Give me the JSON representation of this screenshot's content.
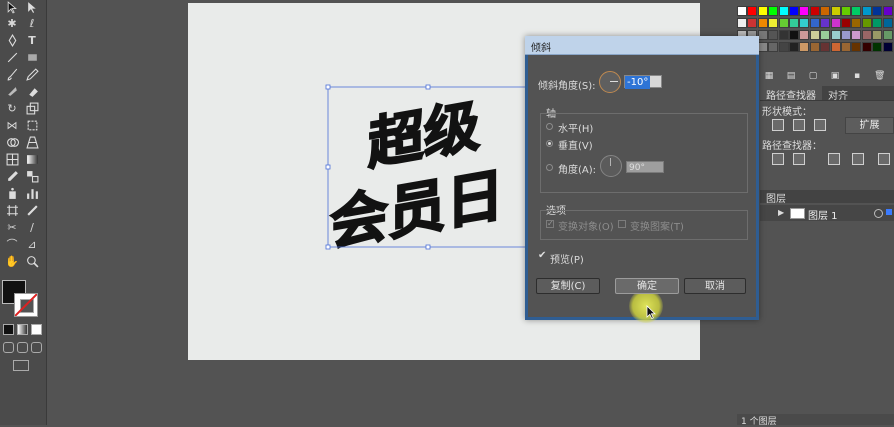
{
  "artwork": {
    "line1": "超级",
    "line2": "会员日"
  },
  "panels": {
    "pathfinder_tab": "路径查找器",
    "align_tab": "对齐",
    "shape_modes_label": "形状模式：",
    "pathfinders_label": "路径查找器：",
    "expand_button": "扩展"
  },
  "layers": {
    "tab": "图层",
    "layer_name": "图层 1",
    "footer": "1 个图层"
  },
  "dialog": {
    "title": "倾斜",
    "shear_angle_label": "倾斜角度(S):",
    "shear_angle_value": "-10°",
    "axis_group_label": "轴",
    "horizontal_label": "水平(H)",
    "vertical_label": "垂直(V)",
    "angle_label": "角度(A):",
    "angle_value": "90°",
    "options_group_label": "选项",
    "transform_objects_label": "变换对象(O)",
    "transform_patterns_label": "变换图案(T)",
    "preview_label": "预览(P)",
    "copy_button": "复制(C)",
    "ok_button": "确定",
    "cancel_button": "取消",
    "axis_selected": "vertical",
    "preview_checked": true,
    "transform_objects_checked": true,
    "transform_patterns_checked": false
  },
  "colors": {
    "dialog_title_bar": "#bfd3ea",
    "highlight": "#d8dc48",
    "selection_bbox": "#4a6fd8",
    "art_fill": "#121212"
  },
  "icons": [
    "selection-tool",
    "direct-selection-tool",
    "pen-tool",
    "type-tool",
    "line-tool",
    "rectangle-tool",
    "paintbrush-tool",
    "pencil-tool",
    "rotate-tool",
    "scale-tool",
    "width-tool",
    "free-transform-tool",
    "shape-builder-tool",
    "perspective-tool",
    "mesh-tool",
    "gradient-tool",
    "eyedropper-tool",
    "blend-tool",
    "symbol-sprayer-tool",
    "graph-tool",
    "artboard-tool",
    "slice-tool",
    "hand-tool",
    "zoom-tool"
  ]
}
